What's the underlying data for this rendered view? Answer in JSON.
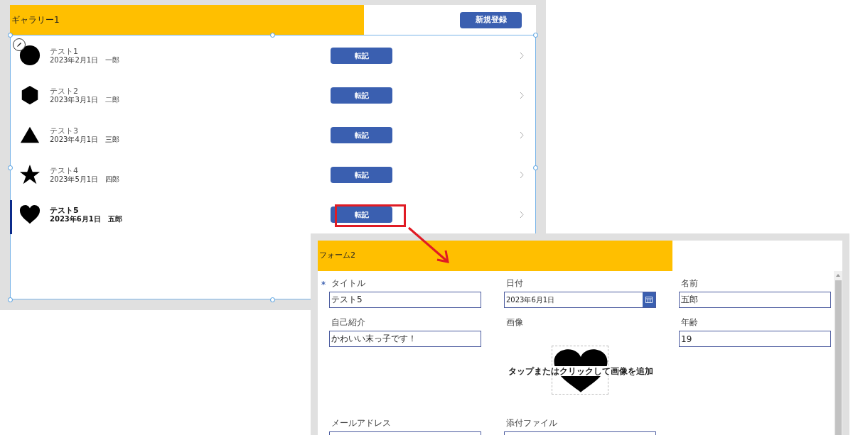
{
  "gallery": {
    "title": "ギャラリー1",
    "new_button": "新規登録",
    "items": [
      {
        "title": "テスト1",
        "date": "2023年2月1日",
        "name": "一郎",
        "kind": "circle",
        "button": "転記",
        "selected": false
      },
      {
        "title": "テスト2",
        "date": "2023年3月1日",
        "name": "二郎",
        "kind": "hexagon",
        "button": "転記",
        "selected": false
      },
      {
        "title": "テスト3",
        "date": "2023年4月1日",
        "name": "三郎",
        "kind": "triangle",
        "button": "転記",
        "selected": false
      },
      {
        "title": "テスト4",
        "date": "2023年5月1日",
        "name": "四郎",
        "kind": "star",
        "button": "転記",
        "selected": false
      },
      {
        "title": "テスト5",
        "date": "2023年6月1日",
        "name": "五郎",
        "kind": "heart",
        "button": "転記",
        "selected": true
      }
    ]
  },
  "form": {
    "title": "フォーム2",
    "fields": [
      {
        "kind": "text",
        "label": "タイトル",
        "required": true,
        "value": "テスト5"
      },
      {
        "kind": "date",
        "label": "日付",
        "required": false,
        "value": "2023年6月1日"
      },
      {
        "kind": "text",
        "label": "名前",
        "required": false,
        "value": "五郎"
      },
      {
        "kind": "text",
        "label": "自己紹介",
        "required": false,
        "value": "かわいい末っ子です！"
      },
      {
        "kind": "image",
        "label": "画像",
        "required": false,
        "hint": "タップまたはクリックして画像を追加"
      },
      {
        "kind": "text",
        "label": "年齢",
        "required": false,
        "value": "19"
      },
      {
        "kind": "text",
        "label": "メールアドレス",
        "required": false
      },
      {
        "kind": "text",
        "label": "添付ファイル",
        "required": false
      }
    ]
  }
}
